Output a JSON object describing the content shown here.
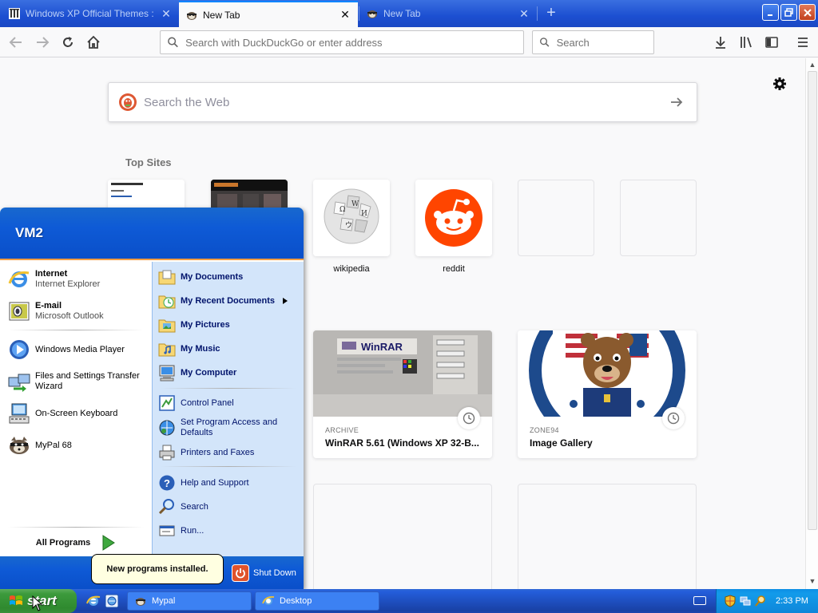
{
  "browser": {
    "tabs": [
      {
        "title": "Windows XP Official Themes : Mic",
        "active": false
      },
      {
        "title": "New Tab",
        "active": true
      },
      {
        "title": "New Tab",
        "active": false
      }
    ],
    "url_placeholder": "Search with DuckDuckGo or enter address",
    "search_placeholder": "Search"
  },
  "newtab": {
    "web_search_placeholder": "Search the Web",
    "top_sites_title": "Top Sites",
    "top_sites": [
      {
        "label": ""
      },
      {
        "label": ""
      },
      {
        "label": "wikipedia"
      },
      {
        "label": "reddit"
      },
      {
        "label": ""
      },
      {
        "label": ""
      }
    ],
    "highlights": [
      {
        "source": "ARCHIVE",
        "title": "WinRAR 5.61 (Windows XP 32-B..."
      },
      {
        "source": "ZONE94",
        "title": "Image Gallery"
      }
    ]
  },
  "start_menu": {
    "user": "VM2",
    "pinned": [
      {
        "title": "Internet",
        "subtitle": "Internet Explorer"
      },
      {
        "title": "E-mail",
        "subtitle": "Microsoft Outlook"
      }
    ],
    "recent": [
      {
        "label": "Windows Media Player"
      },
      {
        "label": "Files and Settings Transfer Wizard"
      },
      {
        "label": "On-Screen Keyboard"
      },
      {
        "label": "MyPal 68"
      }
    ],
    "all_programs": "All Programs",
    "places": [
      {
        "label": "My Documents"
      },
      {
        "label": "My Recent Documents"
      },
      {
        "label": "My Pictures"
      },
      {
        "label": "My Music"
      },
      {
        "label": "My Computer"
      }
    ],
    "settings": [
      {
        "label": "Control Panel"
      },
      {
        "label": "Set Program Access and Defaults"
      },
      {
        "label": "Printers and Faxes"
      }
    ],
    "help": [
      {
        "label": "Help and Support"
      },
      {
        "label": "Search"
      },
      {
        "label": "Run..."
      }
    ],
    "shutdown": "Shut Down"
  },
  "balloon": "New programs installed.",
  "taskbar": {
    "start": "start",
    "tasks": [
      {
        "label": "Mypal"
      },
      {
        "label": "Desktop"
      }
    ],
    "clock": "2:33 PM"
  },
  "colors": {
    "xp_blue": "#245edb",
    "start_green": "#3c9a3c",
    "reddit": "#ff4500",
    "ff_accent": "#0a84ff"
  }
}
